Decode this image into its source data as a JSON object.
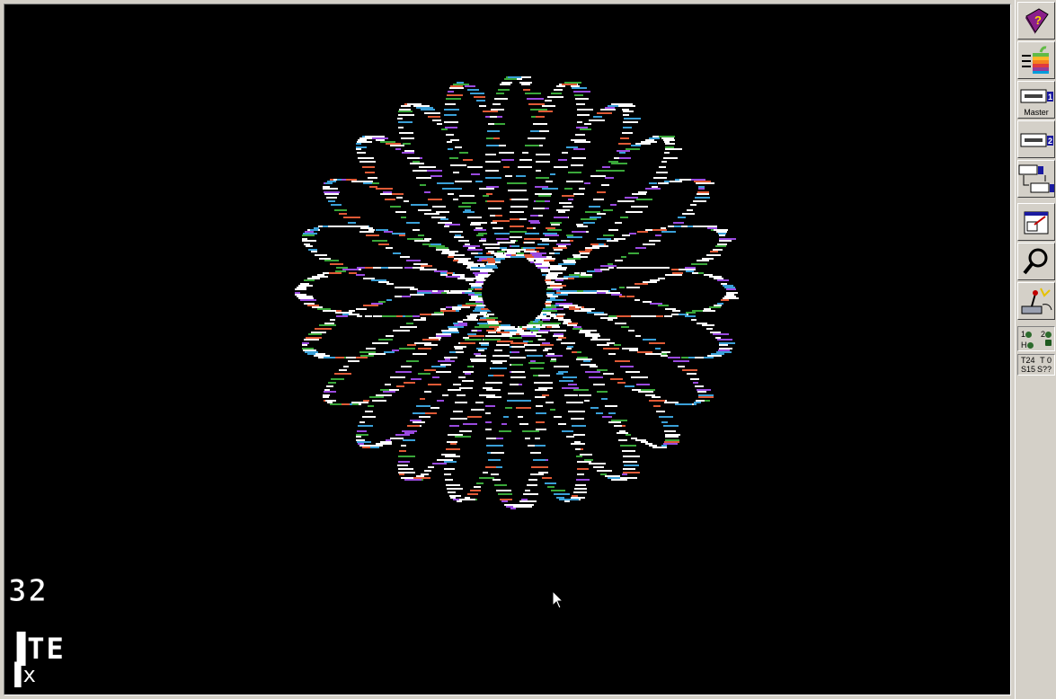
{
  "screen": {
    "counter": "32",
    "line1": "TE",
    "line2": "x"
  },
  "toolbar": {
    "buttons": [
      {
        "name": "help-icon"
      },
      {
        "name": "apple-run-icon"
      },
      {
        "name": "drive-1-icon",
        "caption": "Master"
      },
      {
        "name": "drive-2-icon"
      },
      {
        "name": "swap-drives-icon"
      },
      {
        "name": "fullscreen-icon"
      },
      {
        "name": "debugger-icon"
      },
      {
        "name": "joystick-config-icon"
      }
    ],
    "leds": {
      "d1": "1",
      "d2": "2",
      "hd": "H"
    },
    "status": {
      "track": "T24",
      "t0": "T 0",
      "sector": "S15",
      "s2": "S??"
    }
  },
  "colors": {
    "white": "#ffffff",
    "green": "#3aa83a",
    "orange": "#e05a36",
    "blue": "#3aa0d8",
    "purple": "#9a4ae0"
  }
}
